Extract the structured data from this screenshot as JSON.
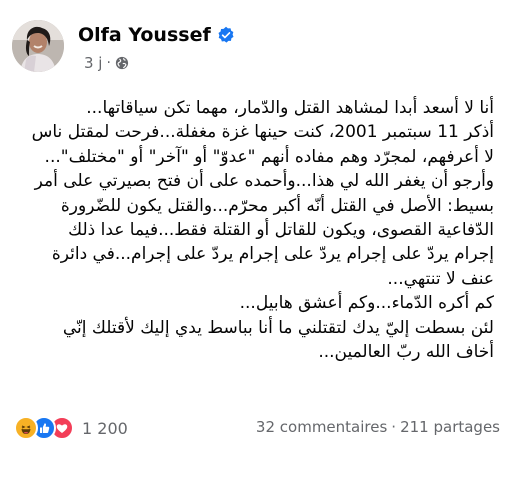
{
  "post": {
    "author": "Olfa Youssef",
    "time": "3 j",
    "separator": "·",
    "audience_icon": "globe-icon",
    "verified_icon": "verified-badge-icon",
    "text_lines": [
      "أنا لا أسعد أبدا لمشاهد القتل والدّمار، مهما تكن سياقاتها...",
      "أذكر 11 سبتمبر 2001، كنت حينها غزة مغفلة...فرحت لمقتل ناس",
      "لا أعرفهم، لمجرّد وهم مفاده أنهم \"عدوّ\" أو \"آخر\" أو \"مختلف\"...",
      "وأرجو أن يغفر الله لي هذا...وأحمده على أن فتح بصيرتي على أمر",
      "بسيط: الأصل في القتل أنّه أكبر محرّم...والقتل يكون للضّرورة",
      "الدّفاعية القصوى، ويكون للقاتل أو القتلة فقط...فيما عدا ذلك",
      "إجرام يردّ على إجرام يردّ على إجرام يردّ على إجرام...في دائرة",
      "عنف لا تنتهي...",
      "كم أكره الدّماء...وكم أعشق هابيل...",
      "لئن بسطت إليّ يدك لتقتلني ما أنا بباسط يدي إليك لأقتلك إنّي",
      "أخاف الله ربّ العالمين..."
    ]
  },
  "footer": {
    "reaction_icons": [
      "haha-icon",
      "like-icon",
      "love-icon"
    ],
    "reaction_count": "1 200",
    "comments": "32 commentaires",
    "stat_separator": "·",
    "shares": "211 partages"
  },
  "colors": {
    "text": "#050505",
    "secondary": "#65676b",
    "verified": "#1877f2",
    "like": "#1877f2",
    "love": "#f33e58",
    "haha": "#f7b125"
  }
}
